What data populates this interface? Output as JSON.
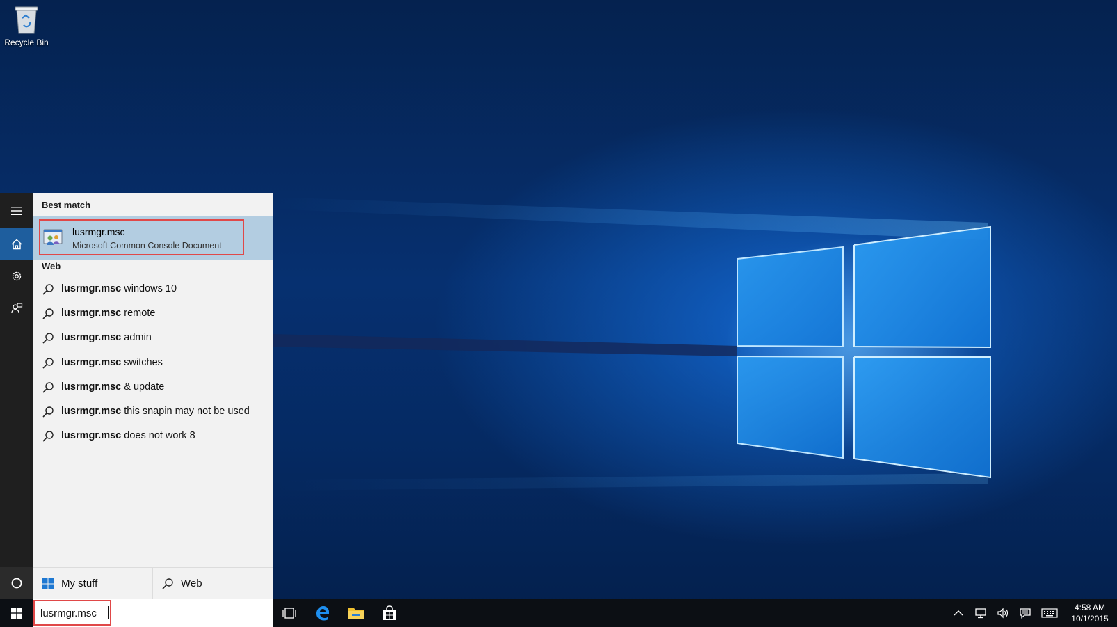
{
  "desktop": {
    "icons": [
      {
        "label": "Recycle Bin",
        "icon": "recycle-bin-icon"
      }
    ]
  },
  "side_rail": {
    "items": [
      {
        "id": "menu",
        "icon": "hamburger-menu-icon"
      },
      {
        "id": "home",
        "icon": "home-icon",
        "active": true
      },
      {
        "id": "settings",
        "icon": "gear-icon"
      },
      {
        "id": "feedback",
        "icon": "feedback-icon"
      }
    ],
    "cortana_icon": "cortana-circle-icon"
  },
  "search_results": {
    "best_match_header": "Best match",
    "best_match": {
      "name": "lusrmgr.msc",
      "description": "Microsoft Common Console Document",
      "icon": "mmc-console-icon"
    },
    "web_header": "Web",
    "web_items": [
      {
        "bold": "lusrmgr.msc",
        "rest": " windows 10"
      },
      {
        "bold": "lusrmgr.msc",
        "rest": " remote"
      },
      {
        "bold": "lusrmgr.msc",
        "rest": " admin"
      },
      {
        "bold": "lusrmgr.msc",
        "rest": " switches"
      },
      {
        "bold": "lusrmgr.msc",
        "rest": " & update"
      },
      {
        "bold": "lusrmgr.msc",
        "rest": " this snapin may not be used"
      },
      {
        "bold": "lusrmgr.msc",
        "rest": " does not work 8"
      }
    ],
    "scope": {
      "my_stuff_label": "My stuff",
      "web_label": "Web"
    }
  },
  "taskbar": {
    "search_value": "lusrmgr.msc",
    "apps": [
      {
        "id": "task-view",
        "icon": "task-view-icon"
      },
      {
        "id": "edge",
        "icon": "edge-icon"
      },
      {
        "id": "file-explorer",
        "icon": "file-explorer-icon"
      },
      {
        "id": "store",
        "icon": "store-icon"
      }
    ],
    "tray": [
      "chevron-up-icon",
      "network-icon",
      "volume-icon",
      "action-center-icon",
      "keyboard-icon"
    ],
    "time": "4:58 AM",
    "date": "10/1/2015"
  },
  "colors": {
    "accent": "#1e5e9e",
    "highlight_box": "#e04848",
    "selected_row": "#b3cde1"
  }
}
